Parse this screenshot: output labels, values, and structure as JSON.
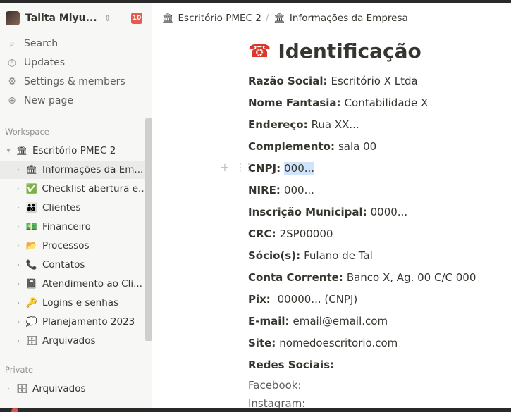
{
  "workspace": {
    "user_name": "Talita Miyu...",
    "badge": "10"
  },
  "nav": [
    {
      "icon": "search-icon",
      "glyph": "⌕",
      "label": "Search"
    },
    {
      "icon": "clock-icon",
      "glyph": "◴",
      "label": "Updates"
    },
    {
      "icon": "gear-icon",
      "glyph": "⚙",
      "label": "Settings & members"
    },
    {
      "icon": "plus-circle-icon",
      "glyph": "⊕",
      "label": "New page"
    }
  ],
  "sections": {
    "workspace": "Workspace",
    "private": "Private"
  },
  "tree": {
    "root": {
      "emoji": "🏛",
      "label": "Escritório PMEC 2"
    },
    "children": [
      {
        "emoji": "🏛",
        "label": "Informações da Em..."
      },
      {
        "emoji": "✅",
        "label": "Checklist abertura e..."
      },
      {
        "emoji": "👪",
        "label": "Clientes"
      },
      {
        "emoji": "💵",
        "label": "Financeiro"
      },
      {
        "emoji": "📂",
        "label": "Processos"
      },
      {
        "emoji": "📞",
        "label": "Contatos"
      },
      {
        "emoji": "📓",
        "label": "Atendimento ao Cli..."
      },
      {
        "emoji": "🔑",
        "label": "Logins e senhas"
      },
      {
        "emoji": "💭",
        "label": "Planejamento 2023"
      },
      {
        "emoji": "🗄",
        "label": "Arquivados"
      }
    ],
    "private": [
      {
        "emoji": "🗄",
        "label": "Arquivados"
      }
    ]
  },
  "breadcrumb": [
    {
      "emoji": "🏛",
      "label": "Escritório PMEC 2"
    },
    {
      "emoji": "🏛",
      "label": "Informações da Empresa"
    }
  ],
  "breadcrumb_sep": "/",
  "page": {
    "emoji": "☎",
    "title": "Identificação",
    "fields": [
      {
        "key": "Razão Social:",
        "value": "Escritório X Ltda"
      },
      {
        "key": "Nome Fantasia:",
        "value": "Contabilidade X"
      },
      {
        "key": "Endereço:",
        "value": "Rua XX..."
      },
      {
        "key": "Complemento:",
        "value": "sala 00"
      },
      {
        "key": "CNPJ:",
        "value": "000..."
      },
      {
        "key": "NIRE:",
        "value": "000..."
      },
      {
        "key": "Inscrição Municipal:",
        "value": "0000..."
      },
      {
        "key": "CRC:",
        "value": "2SP00000"
      },
      {
        "key": "Sócio(s):",
        "value": "Fulano de Tal"
      },
      {
        "key": "Conta Corrente:",
        "value": "Banco X, Ag. 00 C/C 000"
      },
      {
        "key": "Pix:",
        "value": " 00000... (CNPJ)"
      },
      {
        "key": "E-mail:",
        "value": "email@email.com"
      },
      {
        "key": "Site:",
        "value": "nomedoescritorio.com"
      },
      {
        "key": "Redes Sociais:",
        "value": ""
      }
    ],
    "social": [
      "Facebook:",
      "Instagram:"
    ]
  },
  "colors": {
    "sidebar_bg": "#f7f7f5",
    "badge": "#e55b4d",
    "selection": "#cfe3fb",
    "text": "#37352f"
  }
}
